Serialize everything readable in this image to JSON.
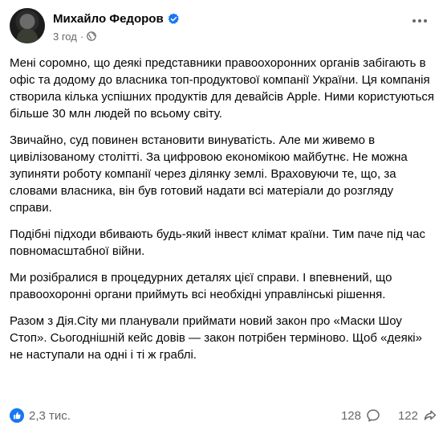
{
  "post": {
    "author": "Михайло Федоров",
    "time": "3 год",
    "separator": "·",
    "paragraphs": [
      "Мені соромно, що деякі представники правоохоронних органів забігають в офіс та додому до власника топ-продуктової компанії України. Ця компанія створила кілька успішних продуктів для девайсів Apple. Ними користуються більше 30 млн людей по всьому світу.",
      "Звичайно, суд повинен встановити винуватість. Але ми живемо в цивілізованому столітті. За цифровою економікою майбутнє. Не можна зупиняти роботу компанії через ділянку землі. Враховуючи те, що, за словами власника, він був готовий надати всі матеріали до розгляду справи.",
      "Подібні підходи вбивають будь-який інвест клімат країни. Тим паче під час повномасштабної війни.",
      "Ми розібралися в процедурних деталях цієї справи. І впевнений, що правоохоронні органи приймуть всі необхідні управлінські рішення.",
      "Разом з Дія.City ми планували приймати новий закон про «Маски Шоу Стоп». Сьогоднішній кейс довів — закон потрібен терміново. Щоб «деякі» не наступали на одні і ті ж граблі."
    ]
  },
  "footer": {
    "reactions_count": "2,3 тис.",
    "comments_count": "128",
    "shares_count": "122"
  },
  "colors": {
    "accent": "#1877f2",
    "muted": "#65676b",
    "text": "#050505"
  },
  "icons": {
    "verified": "verified-badge-icon",
    "audience": "globe-icon",
    "reaction": "like-icon",
    "comments": "comment-icon",
    "shares": "share-icon",
    "more": "more-options-icon"
  }
}
